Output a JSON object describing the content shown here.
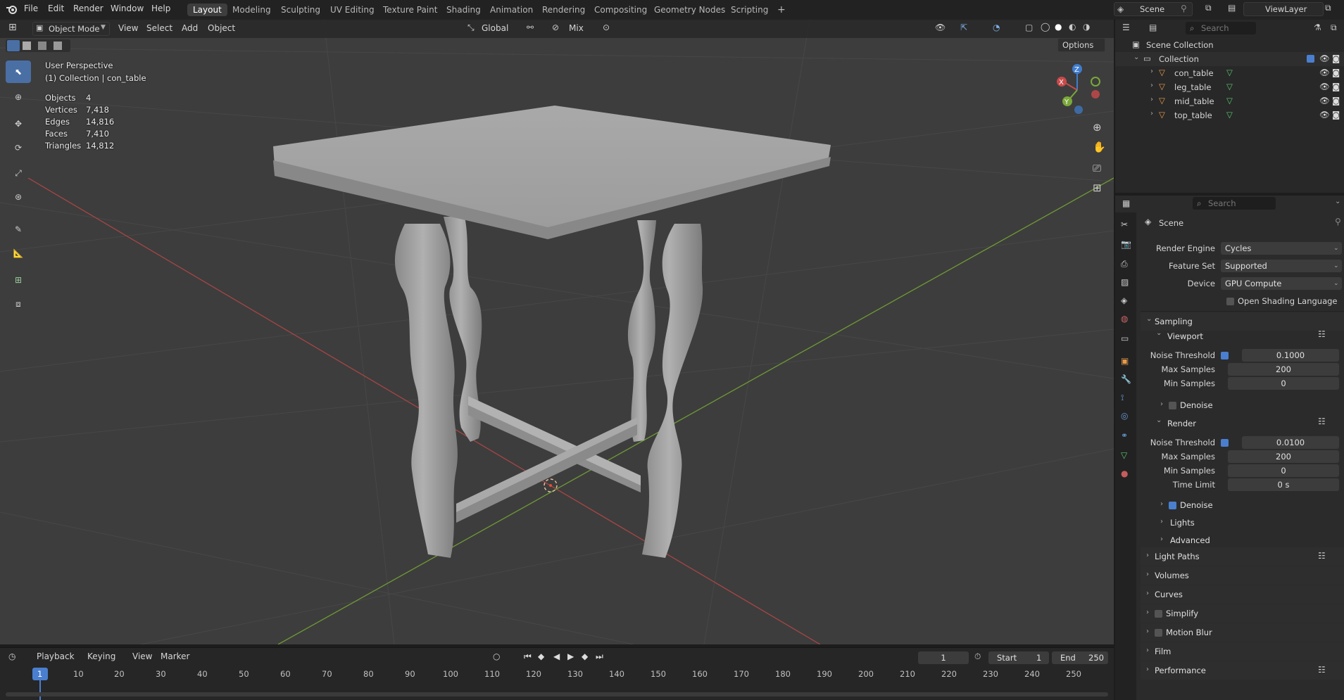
{
  "topbar": {
    "menus": [
      "File",
      "Edit",
      "Render",
      "Window",
      "Help"
    ],
    "workspaces": [
      "Layout",
      "Modeling",
      "Sculpting",
      "UV Editing",
      "Texture Paint",
      "Shading",
      "Animation",
      "Rendering",
      "Compositing",
      "Geometry Nodes",
      "Scripting"
    ],
    "active_workspace": "Layout",
    "add_tab": "+",
    "scene": "Scene",
    "view_layer": "ViewLayer"
  },
  "viewport_header": {
    "mode": "Object Mode",
    "menus": [
      "View",
      "Select",
      "Add",
      "Object"
    ],
    "orientation": "Global",
    "snap_mode": "Mix",
    "options": "Options"
  },
  "viewport": {
    "view_name": "User Perspective",
    "collection_info": "(1) Collection | con_table",
    "stats": [
      {
        "label": "Objects",
        "value": "4"
      },
      {
        "label": "Vertices",
        "value": "7,418"
      },
      {
        "label": "Edges",
        "value": "14,816"
      },
      {
        "label": "Faces",
        "value": "7,410"
      },
      {
        "label": "Triangles",
        "value": "14,812"
      }
    ],
    "gizmo_axes": {
      "x": "X",
      "y": "Y",
      "z": "Z"
    }
  },
  "timeline": {
    "menus": [
      "Playback",
      "Keying",
      "View",
      "Marker"
    ],
    "current_frame": "1",
    "start_label": "Start",
    "start": "1",
    "end_label": "End",
    "end": "250",
    "ticks": [
      "1",
      "10",
      "20",
      "30",
      "40",
      "50",
      "60",
      "70",
      "80",
      "90",
      "100",
      "110",
      "120",
      "130",
      "140",
      "150",
      "160",
      "170",
      "180",
      "190",
      "200",
      "210",
      "220",
      "230",
      "240",
      "250"
    ]
  },
  "outliner": {
    "search_placeholder": "Search",
    "scene_collection": "Scene Collection",
    "collection": "Collection",
    "objects": [
      "con_table",
      "leg_table",
      "mid_table",
      "top_table"
    ]
  },
  "properties": {
    "search_placeholder": "Search",
    "context": "Scene",
    "render_engine_label": "Render Engine",
    "render_engine": "Cycles",
    "feature_set_label": "Feature Set",
    "feature_set": "Supported",
    "device_label": "Device",
    "device": "GPU Compute",
    "osl_label": "Open Shading Language",
    "sampling": "Sampling",
    "viewport_panel": "Viewport",
    "noise_threshold_label": "Noise Threshold",
    "viewport_noise_threshold": "0.1000",
    "max_samples_label": "Max Samples",
    "viewport_max_samples": "200",
    "min_samples_label": "Min Samples",
    "viewport_min_samples": "0",
    "denoise_label": "Denoise",
    "render_panel": "Render",
    "render_noise_threshold": "0.0100",
    "render_max_samples": "200",
    "render_min_samples": "0",
    "time_limit_label": "Time Limit",
    "time_limit": "0 s",
    "lights": "Lights",
    "advanced": "Advanced",
    "light_paths": "Light Paths",
    "volumes": "Volumes",
    "curves": "Curves",
    "simplify": "Simplify",
    "motion_blur": "Motion Blur",
    "film": "Film",
    "performance": "Performance"
  },
  "colors": {
    "accent": "#4a7fd0",
    "x_axis": "#c94a4a",
    "y_axis": "#7aa83a",
    "z_axis": "#3f7dcf",
    "viewport_bg": "#3d3d3d"
  }
}
